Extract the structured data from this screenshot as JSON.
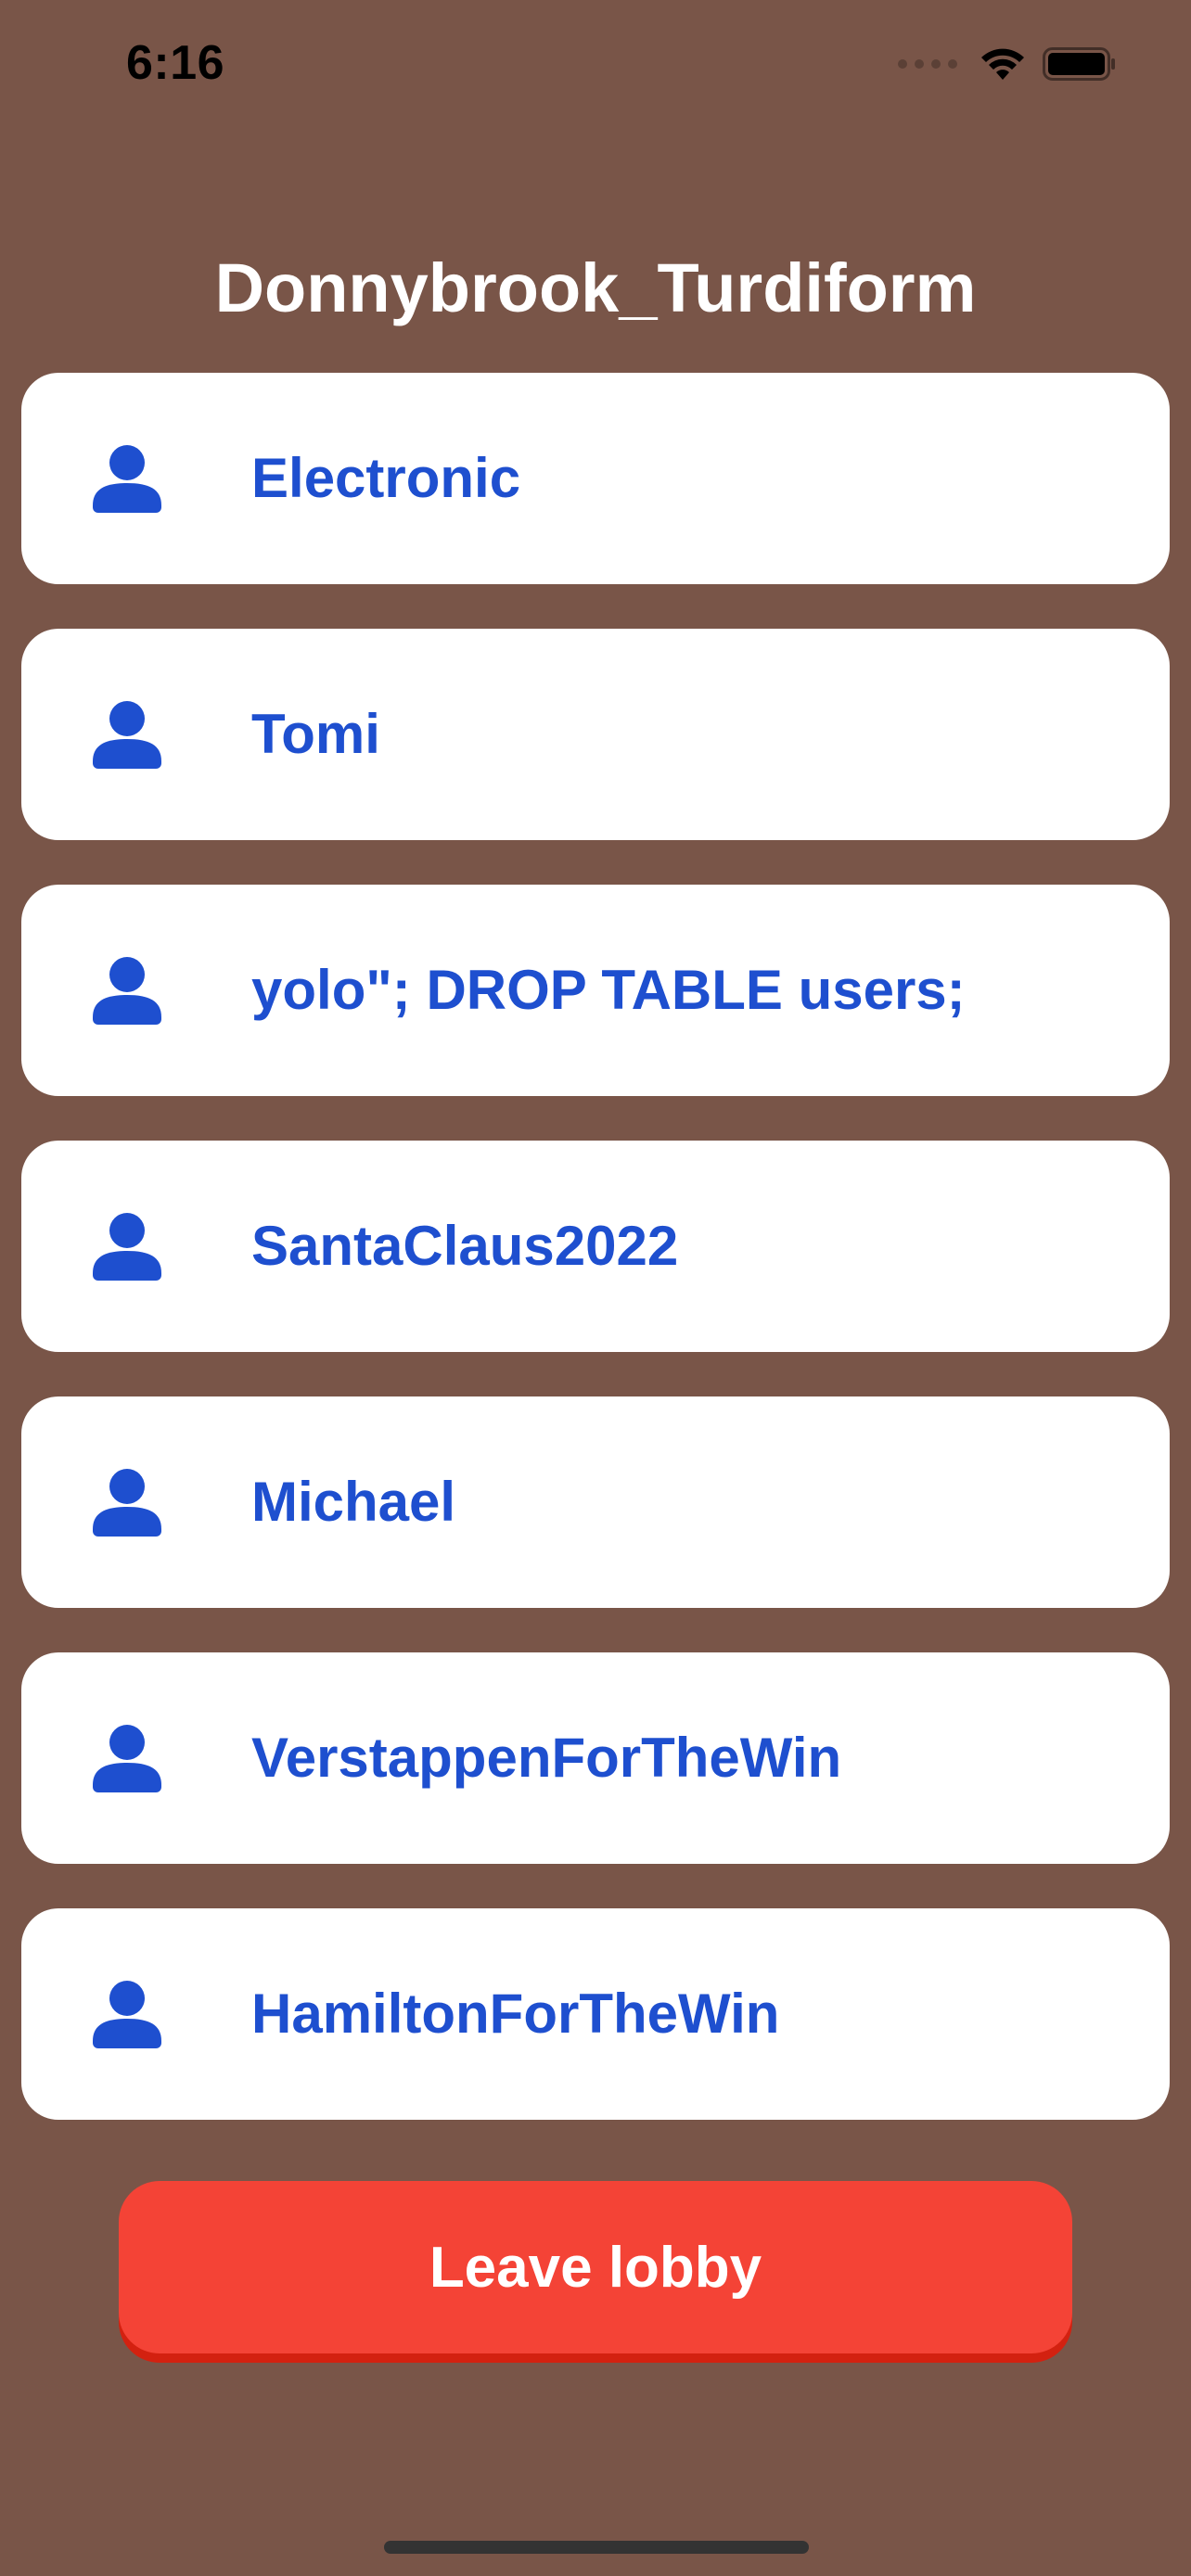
{
  "status_bar": {
    "time": "6:16"
  },
  "lobby": {
    "title": "Donnybrook_Turdiform"
  },
  "players": [
    {
      "name": "Electronic",
      "icon": "person-icon"
    },
    {
      "name": "Tomi",
      "icon": "person-icon"
    },
    {
      "name": "yolo\"; DROP TABLE users;",
      "icon": "person-icon"
    },
    {
      "name": "SantaClaus2022",
      "icon": "person-icon"
    },
    {
      "name": "Michael",
      "icon": "person-icon"
    },
    {
      "name": "VerstappenForTheWin",
      "icon": "person-icon"
    },
    {
      "name": "HamiltonForTheWin",
      "icon": "person-icon"
    }
  ],
  "actions": {
    "leave_label": "Leave lobby"
  },
  "colors": {
    "background": "#795548",
    "card": "#ffffff",
    "accent": "#1e4fcf",
    "leave_button": "#f44336",
    "leave_button_shadow": "#d32110"
  }
}
